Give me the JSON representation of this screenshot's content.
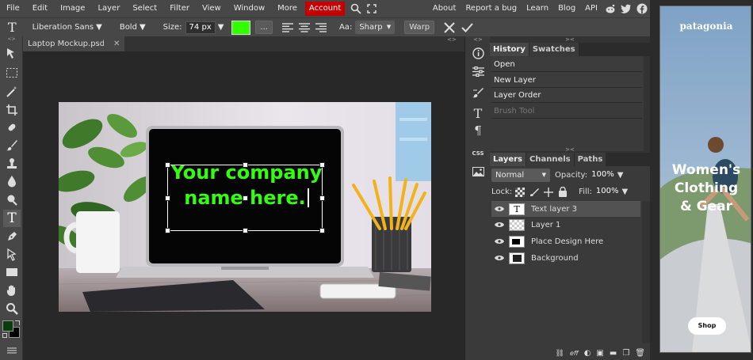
{
  "menu": {
    "items": [
      "File",
      "Edit",
      "Image",
      "Layer",
      "Select",
      "Filter",
      "View",
      "Window",
      "More"
    ],
    "account": "Account",
    "right_links": [
      "About",
      "Report a bug",
      "Learn",
      "Blog",
      "API"
    ]
  },
  "options": {
    "font_family": "Liberation Sans",
    "font_weight": "Bold",
    "size_label": "Size:",
    "size_value": "74 px",
    "text_color": "#33ff00",
    "more_label": "...",
    "aa_label": "Aa:",
    "aa_value": "Sharp",
    "warp_label": "Warp"
  },
  "document": {
    "tab_title": "Laptop Mockup.psd",
    "close": "✕",
    "text_line1": "Your company",
    "text_line2": "name here."
  },
  "toolbar": {
    "fg_color": "#0a3d0a",
    "bg_color": "#000000"
  },
  "history": {
    "tabs": [
      "History",
      "Swatches"
    ],
    "items": [
      "Open",
      "New Layer",
      "Layer Order",
      "Brush Tool"
    ]
  },
  "layers": {
    "tabs": [
      "Layers",
      "Channels",
      "Paths"
    ],
    "blend_mode": "Normal",
    "opacity_label": "Opacity:",
    "opacity_value": "100%",
    "lock_label": "Lock:",
    "fill_label": "Fill:",
    "fill_value": "100%",
    "items": [
      "Text layer 3",
      "Layer 1",
      "Place Design Here",
      "Background"
    ]
  },
  "midbar": {
    "css_label": "CSS"
  },
  "ad": {
    "brand": "patagonia",
    "headline_1": "Women's",
    "headline_2": "Clothing",
    "headline_3": "& Gear",
    "cta": "Shop"
  },
  "colors": {
    "accent_account": "#c40000",
    "text_green": "#33ff11"
  }
}
